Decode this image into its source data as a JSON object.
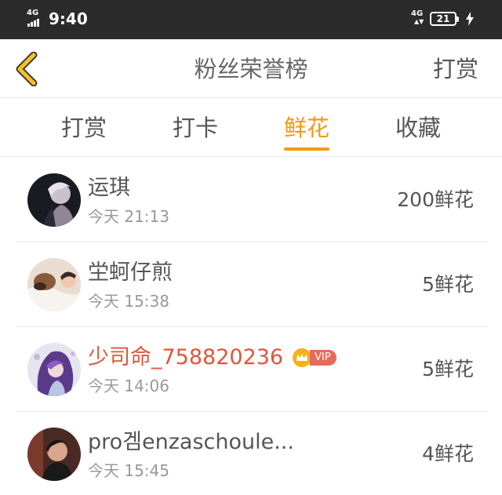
{
  "status_bar": {
    "network_left": "4G",
    "time": "9:40",
    "network_right": "4G",
    "battery": "21"
  },
  "nav": {
    "title": "粉丝荣誉榜",
    "action": "打赏"
  },
  "tabs": [
    {
      "label": "打赏",
      "active": false
    },
    {
      "label": "打卡",
      "active": false
    },
    {
      "label": "鲜花",
      "active": true
    },
    {
      "label": "收藏",
      "active": false
    }
  ],
  "fans": [
    {
      "name": "运琪",
      "time": "今天 21:13",
      "amount": "200鲜花",
      "vip": false
    },
    {
      "name": "坣蚵仔煎",
      "time": "今天 15:38",
      "amount": "5鲜花",
      "vip": false
    },
    {
      "name": "少司命_758820236",
      "time": "今天 14:06",
      "amount": "5鲜花",
      "vip": true,
      "vip_label": "VIP"
    },
    {
      "name": "pro겜enzaschoule...",
      "time": "今天 15:45",
      "amount": "4鲜花",
      "vip": false
    }
  ],
  "colors": {
    "accent": "#f39a11",
    "vip_name": "#e0553b",
    "status_bar": "#2b2b2b"
  }
}
